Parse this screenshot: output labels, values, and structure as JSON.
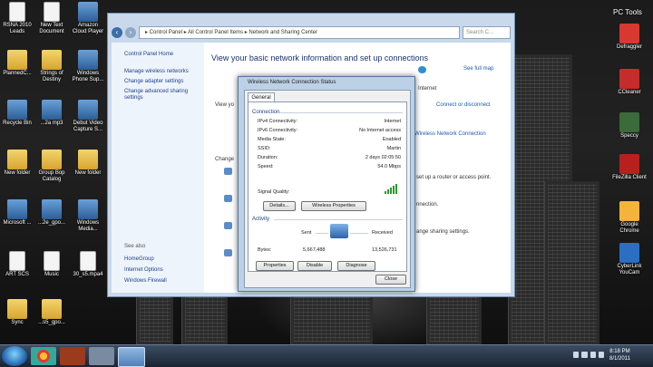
{
  "desktop": {
    "title": "PC Tools",
    "left_icons": [
      {
        "label": "RSNA 2010 Leads",
        "kind": "doc"
      },
      {
        "label": "New Text Document",
        "kind": "doc"
      },
      {
        "label": "Amazon Cloud Player",
        "kind": "app"
      },
      {
        "label": "PlannedC...",
        "kind": "folder"
      },
      {
        "label": "Strings of Destiny",
        "kind": "folder"
      },
      {
        "label": "Windows Phone Sup...",
        "kind": "app"
      },
      {
        "label": "Recycle Bin",
        "kind": "app"
      },
      {
        "label": "...2a mp3",
        "kind": "app"
      },
      {
        "label": "Debut Video Capture S...",
        "kind": "app"
      },
      {
        "label": "New folder",
        "kind": "folder"
      },
      {
        "label": "Group Bop Catalog",
        "kind": "folder"
      },
      {
        "label": "New folder",
        "kind": "folder"
      },
      {
        "label": "Microsoft ...",
        "kind": "app"
      },
      {
        "label": "...2e_gpo...",
        "kind": "app"
      },
      {
        "label": "Windows Media...",
        "kind": "app"
      },
      {
        "label": "ART SCS",
        "kind": "doc"
      },
      {
        "label": "Music",
        "kind": "doc"
      },
      {
        "label": "30_s5.mpa4",
        "kind": "doc"
      },
      {
        "label": "Sync",
        "kind": "folder"
      },
      {
        "label": "...s5_gpo...",
        "kind": "folder"
      }
    ],
    "right_icons": [
      {
        "label": "Defraggler"
      },
      {
        "label": "CCleaner"
      },
      {
        "label": "Speccy"
      },
      {
        "label": "FileZilla Client"
      },
      {
        "label": "Google Chrome"
      },
      {
        "label": "CyberLink YouCam"
      }
    ]
  },
  "explorer": {
    "breadcrumb": "▸ Control Panel ▸ All Control Panel Items ▸ Network and Sharing Center",
    "search_placeholder": "Search C...",
    "left_links": [
      "Control Panel Home",
      "Manage wireless networks",
      "Change adapter settings",
      "Change advanced sharing settings"
    ],
    "see_also_title": "See also",
    "see_also": [
      "HomeGroup",
      "Internet Options",
      "Windows Firewall"
    ],
    "heading": "View your basic network information and set up connections",
    "see_full_map": "See full map",
    "view_your": "View yo",
    "internet": "Internet",
    "connect_disconnect": "Connect or disconnect",
    "wireless_link": "Wireless Network Connection",
    "change_label": "Change",
    "router_text": "set up a router or access point.",
    "connection_text": "nnection.",
    "sharing_text": "ange sharing settings."
  },
  "dialog": {
    "title": "Wireless Network Connection Status",
    "tab": "General",
    "connection_group": "Connection",
    "rows": [
      {
        "label": "IPv4 Connectivity:",
        "value": "Internet"
      },
      {
        "label": "IPv6 Connectivity:",
        "value": "No Internet access"
      },
      {
        "label": "Media State:",
        "value": "Enabled"
      },
      {
        "label": "SSID:",
        "value": "Martin"
      },
      {
        "label": "Duration:",
        "value": "2 days 02:05:50"
      },
      {
        "label": "Speed:",
        "value": "54.0 Mbps"
      }
    ],
    "signal_label": "Signal Quality:",
    "signal_bars": 5,
    "details_button": "Details...",
    "wireless_props_button": "Wireless Properties",
    "activity_group": "Activity",
    "sent_label": "Sent",
    "received_label": "Received",
    "bytes_label": "Bytes:",
    "bytes_sent": "5,667,488",
    "bytes_received": "13,526,731",
    "properties_button": "Properties",
    "disable_button": "Disable",
    "diagnose_button": "Diagnose",
    "close_button": "Close"
  },
  "taskbar": {
    "time": "8:18 PM",
    "date": "8/1/2011"
  }
}
